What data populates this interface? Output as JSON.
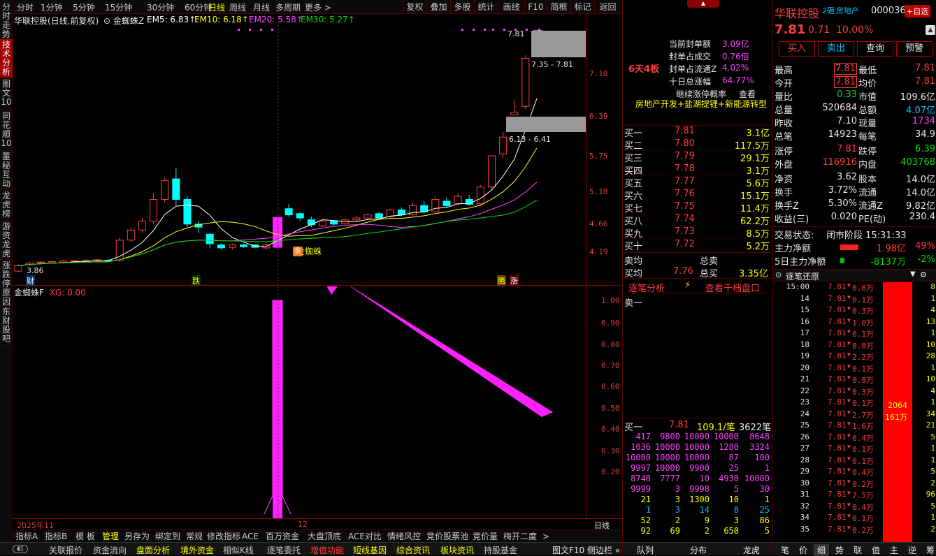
{
  "sidebar": {
    "tabs": [
      "分时走势",
      "技术分析",
      "图文10",
      "同花顺10",
      "董秘互动",
      "龙虎榜",
      "游资龙虎",
      "涨跌停原因",
      "东财股吧"
    ],
    "active": 1
  },
  "periods": [
    "分时",
    "1分钟",
    "5分钟",
    "15分钟",
    "30分钟",
    "60分钟",
    "日线",
    "周线",
    "月线",
    "多周期",
    "更多 >"
  ],
  "period_active": "日线",
  "toolbar": [
    "复权",
    "叠加",
    "多股",
    "统计",
    "画线",
    "F10",
    "简框",
    "标记",
    "返回"
  ],
  "infobar": {
    "name": "华联控股(日线,前复权)",
    "indicator": "金蜘蛛Z",
    "em5": "EM5: 6.83↑",
    "em10": "EM10: 6.18↑",
    "em20": "EM20: 5.58↑",
    "em30": "EM30: 5.27↑"
  },
  "main_yaxis": [
    "7.10",
    "6.39",
    "5.75",
    "5.18",
    "4.66",
    "4.19"
  ],
  "annotations": {
    "high_box": "7.81",
    "range_top": "7.35 - 7.81",
    "range_mid": "6.13 - 6.41",
    "low": "3.86",
    "jinzhizhu": "金蜘蛛",
    "cai": "财",
    "die": "跌",
    "teng": "腾",
    "zhang": "涨"
  },
  "sub_indicator": {
    "name": "金蜘蛛F",
    "xg": "XG: 0.00"
  },
  "sub_yaxis": [
    "1.00",
    "0.90",
    "0.80",
    "0.70",
    "0.60",
    "0.50",
    "0.40",
    "0.30",
    "0.20"
  ],
  "xaxis": {
    "left": "2025年11",
    "mid": "12",
    "period": "日线"
  },
  "bottom_tabs": [
    "指标A",
    "指标B",
    "模 板",
    "管理",
    "另存为",
    "绑定到",
    "常规",
    "修改指标",
    "ACE",
    "百万资金",
    "大盘顶底",
    "ACE对比",
    "情绪风控",
    "竞价股票池",
    "竞价量",
    "梅开二度",
    ">"
  ],
  "statusbar": [
    "关联报价",
    "资金流向",
    "盘面分析",
    "境外资金",
    "相似K线",
    "逐笔委托",
    "增值功能",
    "短线基因",
    "综合资讯",
    "板块资讯",
    "持股基金",
    "图文F10 侧边栏 «"
  ],
  "limit_info": {
    "badge": "6天4板",
    "concept": "房地产开发+盐湖提锂+新能源转型",
    "rows": [
      [
        "当前封单额",
        "3.09亿"
      ],
      [
        "封单占成交",
        "0.76倍"
      ],
      [
        "封单占流通Z",
        "4.02%"
      ],
      [
        "十日总涨幅",
        "64.77%"
      ],
      [
        "继续涨停概率",
        "查看"
      ]
    ]
  },
  "bids": [
    [
      "买一",
      "7.81",
      "3.1亿"
    ],
    [
      "买二",
      "7.80",
      "117.5万"
    ],
    [
      "买三",
      "7.79",
      "29.1万"
    ],
    [
      "买四",
      "7.78",
      "3.1万"
    ],
    [
      "买五",
      "7.77",
      "5.6万"
    ],
    [
      "买六",
      "7.76",
      "15.1万"
    ],
    [
      "买七",
      "7.75",
      "11.4万"
    ],
    [
      "买八",
      "7.74",
      "62.2万"
    ],
    [
      "买九",
      "7.73",
      "8.5万"
    ],
    [
      "买十",
      "7.72",
      "5.2万"
    ]
  ],
  "avg": {
    "sell_avg": "卖均",
    "total_sell": "总卖",
    "buy_avg": "买均",
    "buy_avg_val": "7.76",
    "total_buy": "总买",
    "total_buy_val": "3.35亿"
  },
  "tab2": {
    "a": "逐笔分析",
    "b": "查看千档盘口",
    "sell1": "卖一"
  },
  "queue": {
    "label": "买一",
    "price": "7.81",
    "amt": "109.1/笔",
    "count": "3622笔",
    "rows": [
      [
        "417",
        "9800",
        "10000",
        "10000",
        "8648"
      ],
      [
        "1036",
        "10000",
        "10000",
        "1280",
        "3324"
      ],
      [
        "10000",
        "10000",
        "10000",
        "87",
        "100"
      ],
      [
        "9997",
        "10000",
        "9900",
        "25",
        "1"
      ],
      [
        "8748",
        "7777",
        "10",
        "4930",
        "10000"
      ],
      [
        "9999",
        "3",
        "9998",
        "5",
        "30"
      ],
      [
        "21",
        "3",
        "1300",
        "10",
        "1"
      ],
      [
        "1",
        "3",
        "14",
        "8",
        "25"
      ],
      [
        "52",
        "2",
        "9",
        "3",
        "86"
      ],
      [
        "92",
        "69",
        "2",
        "650",
        "5"
      ]
    ]
  },
  "panel2_tabs": [
    "队列",
    "分布",
    "龙虎"
  ],
  "stock": {
    "name": "华联控股",
    "tag": "2砸",
    "sector": "房地产",
    "code": "000036",
    "add": "+自选",
    "price": "7.81",
    "change": "0.71",
    "pct": "10.00%"
  },
  "actions": [
    "买入",
    "卖出",
    "查询",
    "预警"
  ],
  "quote": [
    [
      "最高",
      "7.81",
      "最低",
      "7.81"
    ],
    [
      "今开",
      "7.81",
      "均价",
      "7.81"
    ],
    [
      "量比",
      "0.33",
      "市值",
      "109.6亿"
    ],
    [
      "总量",
      "520684",
      "总额",
      "4.07亿"
    ],
    [
      "昨收",
      "7.10",
      "现量",
      "1734"
    ],
    [
      "总笔",
      "14923",
      "每笔",
      "34.9"
    ],
    [
      "涨停",
      "7.81",
      "跌停",
      "6.39"
    ],
    [
      "外盘",
      "116916",
      "内盘",
      "403768"
    ],
    [
      "净资",
      "3.62",
      "股本",
      "14.0亿"
    ],
    [
      "换手",
      "3.72%",
      "流通",
      "14.0亿"
    ],
    [
      "换手Z",
      "5.30%",
      "流通Z",
      "9.82亿"
    ],
    [
      "收益(三)",
      "0.020",
      "PE(动)",
      "230.4"
    ]
  ],
  "status": {
    "label": "交易状态:",
    "value": "闭市阶段 15:31:33"
  },
  "flow": [
    [
      "主力净额",
      "1.98亿",
      "49%"
    ],
    [
      "5日主力净额",
      "-8137万",
      "-2%"
    ]
  ],
  "ticks_title": "逐笔还原",
  "ticks": [
    [
      "15:00",
      "7.81",
      "0.6万",
      "8"
    ],
    [
      "14",
      "7.81",
      "0.1万",
      "1"
    ],
    [
      "15",
      "7.81",
      "0.3万",
      "4"
    ],
    [
      "16",
      "7.81",
      "1.0万",
      "13"
    ],
    [
      "17",
      "7.81",
      "0.1万",
      "1"
    ],
    [
      "18",
      "7.81",
      "0.8万",
      "10"
    ],
    [
      "19",
      "7.81",
      "2.2万",
      "28"
    ],
    [
      "20",
      "7.81",
      "0.1万",
      "1"
    ],
    [
      "21",
      "7.81",
      "0.8万",
      "10"
    ],
    [
      "22",
      "7.81",
      "0.3万",
      "4"
    ],
    [
      "23",
      "7.81",
      "0.1万",
      "1"
    ],
    [
      "24",
      "7.81",
      "2.7万",
      "34"
    ],
    [
      "25",
      "7.81",
      "1.6万",
      "21"
    ],
    [
      "26",
      "7.81",
      "0.4万",
      "5"
    ],
    [
      "27",
      "7.81",
      "0.1万",
      "1"
    ],
    [
      "28",
      "7.81",
      "0.1万",
      "1"
    ],
    [
      "29",
      "7.81",
      "0.4万",
      "5"
    ],
    [
      "30",
      "7.81",
      "0.2万",
      "2"
    ],
    [
      "31",
      "7.81",
      "7.5万",
      "96"
    ],
    [
      "32",
      "7.81",
      "0.4万",
      "5"
    ],
    [
      "34",
      "7.81",
      "0.1万",
      "1"
    ],
    [
      "35",
      "7.81",
      "0.2万",
      "2"
    ]
  ],
  "ticks_bar": {
    "count": "2064",
    "amount": "161万"
  },
  "right_tabs": [
    "笔",
    "价",
    "细",
    "势",
    "联",
    "值",
    "主",
    "逆",
    "筹"
  ]
}
